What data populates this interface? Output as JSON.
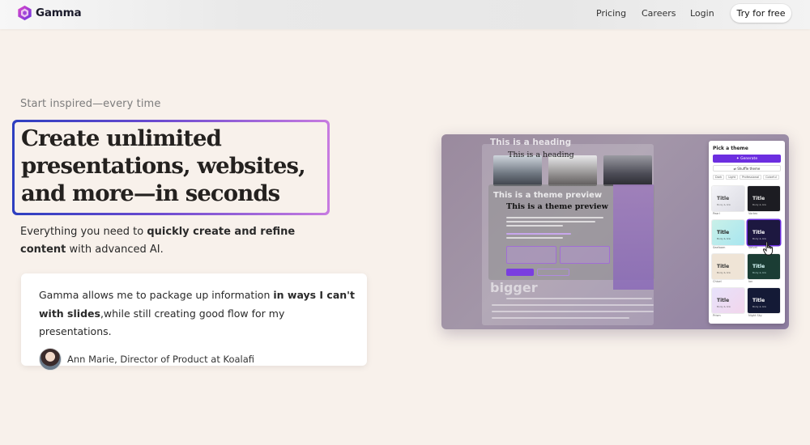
{
  "nav": {
    "brand": "Gamma",
    "links": [
      {
        "label": "Pricing"
      },
      {
        "label": "Careers"
      },
      {
        "label": "Login"
      }
    ],
    "cta": "Try for free"
  },
  "hero": {
    "eyebrow": "Start inspired—every time",
    "headline_line1": "Create unlimited",
    "headline_line2": "presentations, websites,",
    "headline_line3": "and more—in seconds",
    "sub_pre": "Everything you need to ",
    "sub_bold": "quickly create and refine content",
    "sub_post": " with advanced AI."
  },
  "testimonial": {
    "quote_pre": "Gamma allows me to package up information ",
    "quote_bold": "in ways I can't with slides",
    "quote_post": ",while still creating good flow for my presentations.",
    "author": "Ann Marie, Director of Product at Koalafi"
  },
  "product_shot": {
    "ghost_heading": "This is a heading",
    "slide_title": "This is a heading",
    "theme_preview_ghost": "This is a theme preview",
    "theme_preview_title": "This is a theme preview",
    "bigger_text": "bigger",
    "picker": {
      "title": "Pick a theme",
      "generate": "Generate",
      "shuffle": "Shuffle theme",
      "chips": [
        "Dark",
        "Light",
        "Professional",
        "Colorful"
      ],
      "thumbs": [
        {
          "title": "Title",
          "sub": "Body & link",
          "label": "Pearl",
          "bg": "#eeeef2",
          "fg": "#444"
        },
        {
          "title": "Title",
          "sub": "Body & link",
          "label": "Vortex",
          "bg": "#1c1c22",
          "fg": "#eee"
        },
        {
          "title": "Title",
          "sub": "Body & link",
          "label": "Seafoam",
          "bg": "#d8f3ee",
          "fg": "#222"
        },
        {
          "title": "Title",
          "sub": "Body & link",
          "label": "Velvet",
          "bg": "#1d1840",
          "fg": "#fff"
        },
        {
          "title": "Title",
          "sub": "Body & link",
          "label": "Chisel",
          "bg": "#efe4d6",
          "fg": "#333"
        },
        {
          "title": "Title",
          "sub": "Body & link",
          "label": "Ion",
          "bg": "#1b3d34",
          "fg": "#dff"
        },
        {
          "title": "Title",
          "sub": "Body & link",
          "label": "Prism",
          "bg": "#eae4f8",
          "fg": "#333"
        },
        {
          "title": "Title",
          "sub": "Body & link",
          "label": "Night Sky",
          "bg": "#141a36",
          "fg": "#fff"
        }
      ]
    }
  },
  "colors": {
    "page_bg": "#f8f1eb",
    "gradient_start": "#2d3fc0",
    "gradient_end": "#c77be0",
    "accent_purple": "#6c2ee0"
  }
}
